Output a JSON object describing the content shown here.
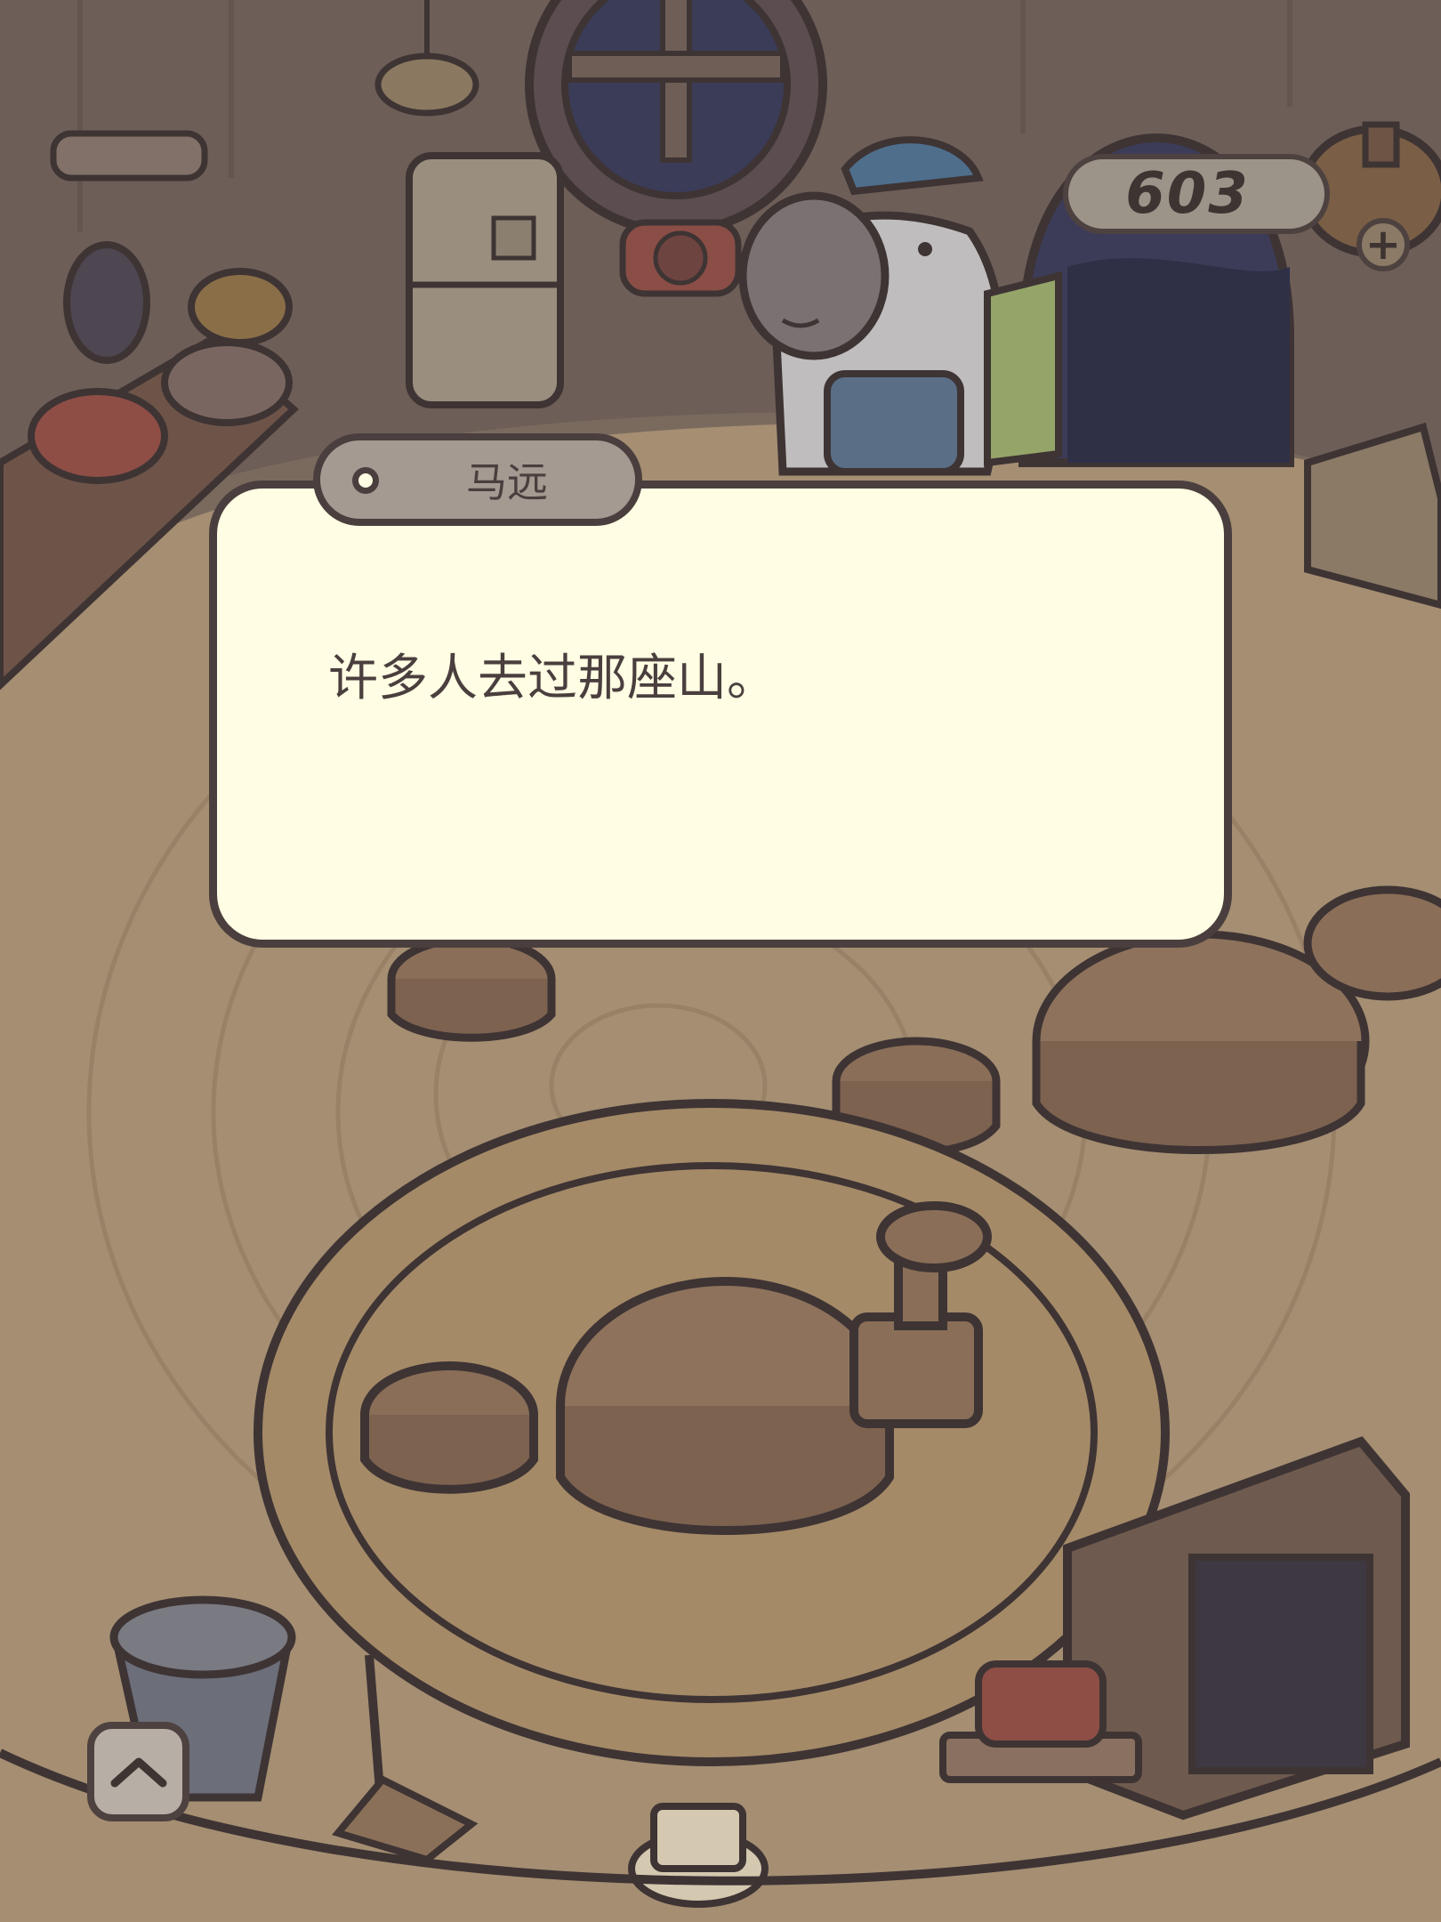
{
  "hud": {
    "currency_value": "603",
    "currency_icon": "acorn-pot-icon",
    "add_currency_icon": "plus-icon"
  },
  "dialog": {
    "speaker_name": "马远",
    "speaker_icon": "dot-icon",
    "text": "许多人去过那座山。"
  },
  "controls": {
    "expand_icon": "chevron-up-icon"
  },
  "colors": {
    "dialog_bg": "#fffde3",
    "outline": "#4a3f3e",
    "nametag_bg": "#a49a91",
    "floor": "#b89e7e"
  }
}
